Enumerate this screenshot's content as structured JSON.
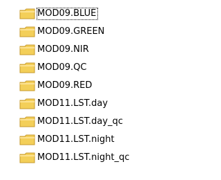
{
  "folder_list": {
    "items": [
      {
        "label": "MOD09.BLUE",
        "icon": "folder-icon",
        "selected": true
      },
      {
        "label": "MOD09.GREEN",
        "icon": "folder-icon",
        "selected": false
      },
      {
        "label": "MOD09.NIR",
        "icon": "folder-icon",
        "selected": false
      },
      {
        "label": "MOD09.QC",
        "icon": "folder-icon",
        "selected": false
      },
      {
        "label": "MOD09.RED",
        "icon": "folder-icon",
        "selected": false
      },
      {
        "label": "MOD11.LST.day",
        "icon": "folder-icon",
        "selected": false
      },
      {
        "label": "MOD11.LST.day_qc",
        "icon": "folder-icon",
        "selected": false
      },
      {
        "label": "MOD11.LST.night",
        "icon": "folder-icon",
        "selected": false
      },
      {
        "label": "MOD11.LST.night_qc",
        "icon": "folder-icon",
        "selected": false
      }
    ]
  },
  "colors": {
    "folder_fill": "#f3cf59",
    "folder_stroke": "#c79a2b",
    "folder_highlight": "#ffe9a6"
  }
}
